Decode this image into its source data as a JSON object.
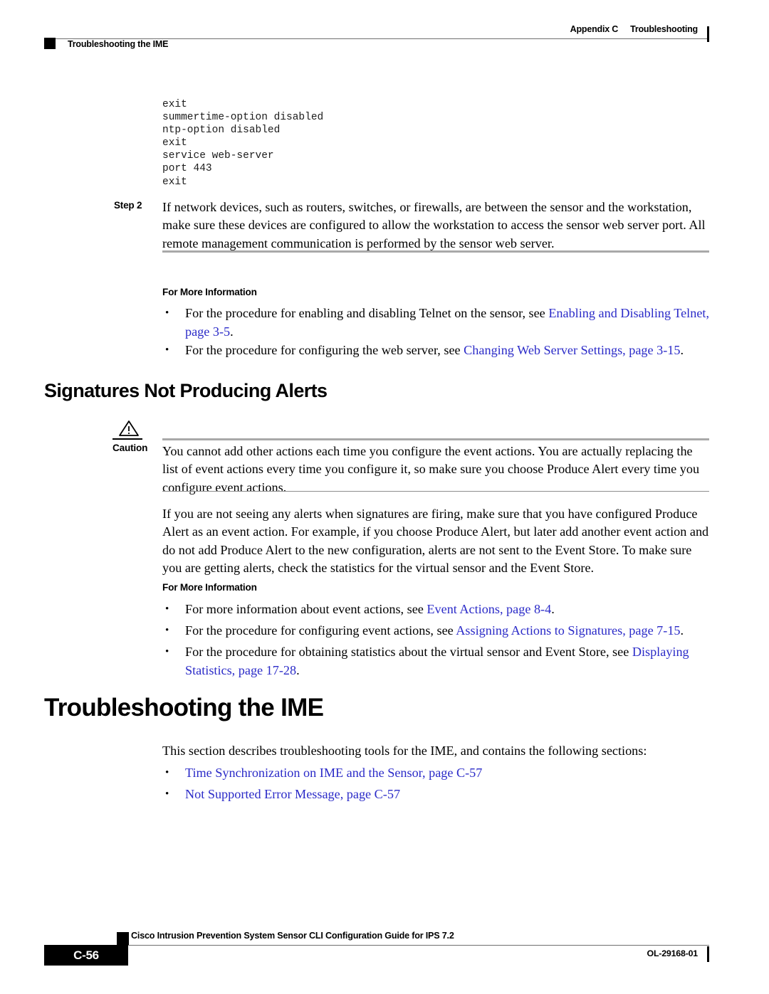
{
  "header": {
    "left_title": "Troubleshooting the IME",
    "right_appendix": "Appendix C",
    "right_section": "Troubleshooting"
  },
  "code_block": {
    "lines": "exit\nsummertime-option disabled\nntp-option disabled\nexit\nservice web-server\nport 443\nexit"
  },
  "step": {
    "label": "Step 2",
    "text": "If network devices, such as routers, switches, or firewalls, are between the sensor and the workstation, make sure these devices are configured to allow the workstation to access the sensor web server port. All remote management communication is performed by the sensor web server."
  },
  "more_info_1": {
    "heading": "For More Information",
    "bullets": [
      {
        "bullet": "•",
        "lead": "For the procedure for enabling and disabling Telnet on the sensor, see ",
        "link": "Enabling and Disabling Telnet, page 3-5",
        "tail": "."
      },
      {
        "bullet": "•",
        "lead": "For the procedure for configuring the web server, see ",
        "link": "Changing Web Server Settings, page 3-15",
        "tail": "."
      }
    ]
  },
  "section_heading": "Signatures Not Producing Alerts",
  "caution": {
    "icon": "warning-triangle-icon",
    "label": "Caution",
    "text": "You cannot add other actions each time you configure the event actions. You are actually replacing the list of event actions every time you configure it, so make sure you choose Produce Alert every time you configure event actions."
  },
  "body_paragraph": "If you are not seeing any alerts when signatures are firing, make sure that you have configured Produce Alert as an event action. For example, if you choose Produce Alert, but later add another event action and do not add Produce Alert to the new configuration, alerts are not sent to the Event Store. To make sure you are getting alerts, check the statistics for the virtual sensor and the Event Store.",
  "more_info_2": {
    "heading": "For More Information",
    "bullets": [
      {
        "bullet": "•",
        "lead": "For more information about event actions, see ",
        "link": "Event Actions, page 8-4",
        "tail": "."
      },
      {
        "bullet": "•",
        "lead": "For the procedure for configuring event actions, see ",
        "link": "Assigning Actions to Signatures, page 7-15",
        "tail": "."
      },
      {
        "bullet": "•",
        "lead": "For the procedure for obtaining statistics about the virtual sensor and Event Store, see ",
        "link": "Displaying Statistics, page 17-28",
        "tail": "."
      }
    ]
  },
  "chapter_heading": "Troubleshooting the IME",
  "intro_paragraph": "This section describes troubleshooting tools for the IME, and contains the following sections:",
  "toc_bullets": [
    {
      "bullet": "•",
      "link": "Time Synchronization on IME and the Sensor, page C-57"
    },
    {
      "bullet": "•",
      "link": "Not Supported Error Message, page C-57"
    }
  ],
  "footer": {
    "title": "Cisco Intrusion Prevention System Sensor CLI Configuration Guide for IPS 7.2",
    "page_number": "C-56",
    "doc_id": "OL-29168-01"
  },
  "colors": {
    "link": "#2b2bc8",
    "rule_gray": "#a9a9a9",
    "rule_thin": "#8e8e8e",
    "text": "#000000"
  }
}
